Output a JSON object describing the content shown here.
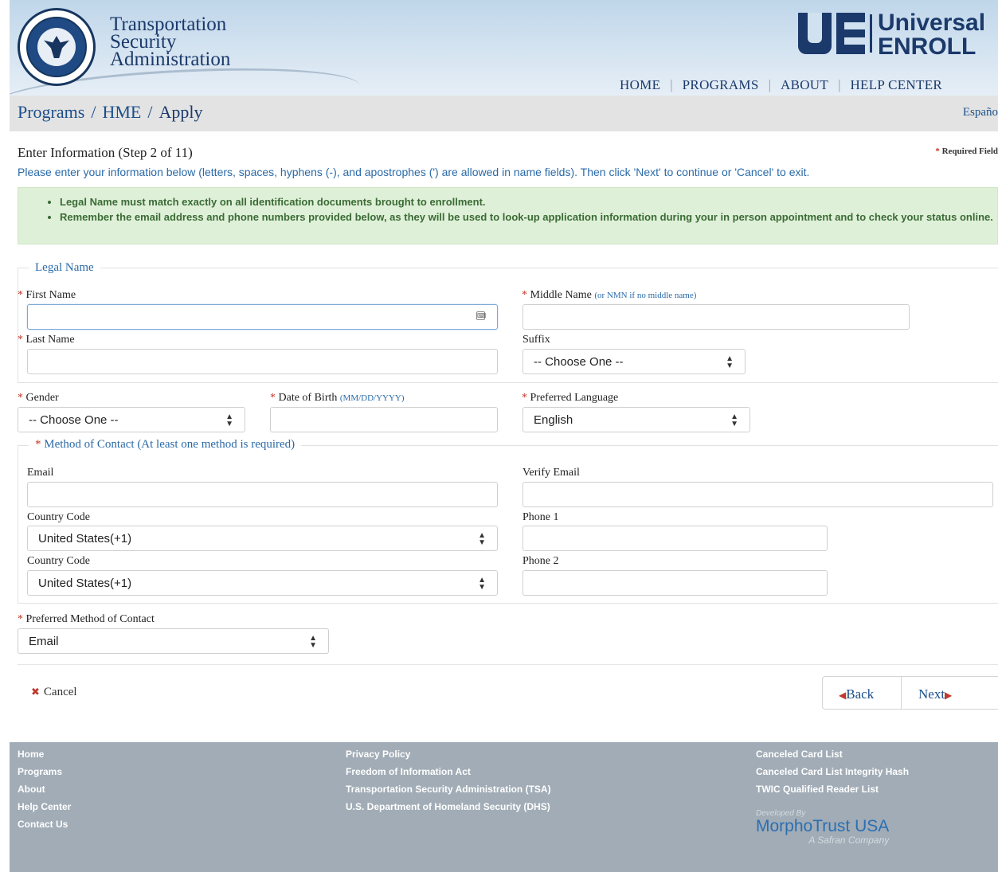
{
  "header": {
    "agency_lines": [
      "Transportation",
      "Security",
      "Administration"
    ],
    "seal_text": "DEPARTMENT OF HOMELAND SECURITY",
    "logo_top": "Universal",
    "logo_bottom": "ENROLL",
    "nav": [
      "HOME",
      "PROGRAMS",
      "ABOUT",
      "HELP CENTER"
    ],
    "nav_separator": "|"
  },
  "breadcrumb": {
    "items": [
      "Programs",
      "HME",
      "Apply"
    ],
    "separator": "/",
    "language_link": "Españo"
  },
  "form_header": {
    "step_title": "Enter Information (Step 2 of 11)",
    "required_note": "Required Field",
    "instructions": "Please enter your information below (letters, spaces, hyphens (-), and apostrophes (') are allowed in name fields). Then click 'Next' to continue or 'Cancel' to exit."
  },
  "notice": {
    "items": [
      "Legal Name must match exactly on all identification documents brought to enrollment.",
      "Remember the email address and phone numbers provided below, as they will be used to look-up application information during your in person appointment and to check your status online."
    ]
  },
  "legal_name": {
    "legend": "Legal Name",
    "first_name_label": "First Name",
    "first_name_value": "",
    "middle_name_label": "Middle Name",
    "middle_name_hint": "(or NMN if no middle name)",
    "middle_name_value": "",
    "last_name_label": "Last Name",
    "last_name_value": "",
    "suffix_label": "Suffix",
    "suffix_value": "-- Choose One --"
  },
  "personal": {
    "gender_label": "Gender",
    "gender_value": "-- Choose One --",
    "dob_label": "Date of Birth",
    "dob_hint": "(MM/DD/YYYY)",
    "dob_value": "",
    "language_label": "Preferred Language",
    "language_value": "English"
  },
  "contact": {
    "legend": "Method of Contact (At least one method is required)",
    "email_label": "Email",
    "email_value": "",
    "verify_email_label": "Verify Email",
    "verify_email_value": "",
    "country_code_label_1": "Country Code",
    "country_code_value_1": "United States(+1)",
    "phone1_label": "Phone 1",
    "phone1_value": "",
    "country_code_label_2": "Country Code",
    "country_code_value_2": "United States(+1)",
    "phone2_label": "Phone 2",
    "phone2_value": ""
  },
  "preferred_contact": {
    "label": "Preferred Method of Contact",
    "value": "Email"
  },
  "actions": {
    "cancel": "Cancel",
    "back": "Back",
    "next": "Next"
  },
  "footer": {
    "col1": [
      "Home",
      "Programs",
      "About",
      "Help Center",
      "Contact Us"
    ],
    "col2": [
      "Privacy Policy",
      "Freedom of Information Act",
      "Transportation Security Administration (TSA)",
      "U.S. Department of Homeland Security (DHS)"
    ],
    "col3": [
      "Canceled Card List",
      "Canceled Card List Integrity Hash",
      "TWIC Qualified Reader List"
    ],
    "developed_by": "Developed By",
    "developer": "MorphoTrust USA",
    "developer_sub": "A Safran Company"
  },
  "colors": {
    "brand_navy": "#1b3a6b",
    "link_blue": "#2a6aa8",
    "required_red": "#c0392b",
    "notice_bg": "#dff0d8",
    "notice_text": "#3a6b35",
    "footer_bg": "#a1acb6"
  },
  "icons": {
    "seal": "dhs-seal-icon",
    "required": "asterisk-icon",
    "select": "updown-arrows-icon",
    "keyboard": "keyboard-icon",
    "cancel": "x-icon",
    "back": "triangle-left-icon",
    "next": "triangle-right-icon"
  }
}
